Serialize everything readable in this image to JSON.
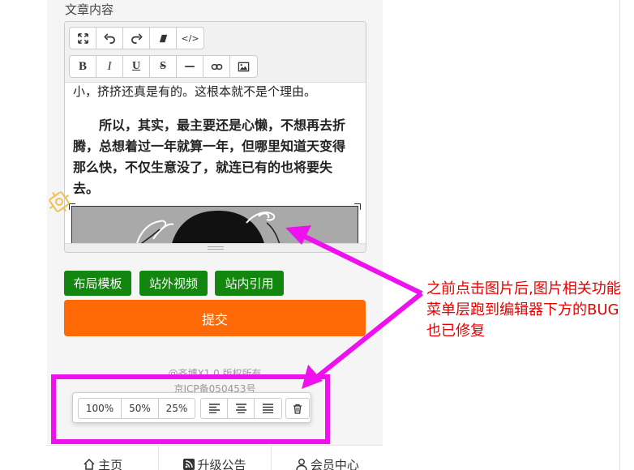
{
  "form": {
    "content_label": "文章内容"
  },
  "editor": {
    "toolbar_row1": [
      {
        "name": "fullscreen-icon"
      },
      {
        "name": "undo-icon"
      },
      {
        "name": "redo-icon"
      },
      {
        "name": "eraser-icon"
      },
      {
        "name": "code-icon",
        "label": "</>"
      }
    ],
    "toolbar_row2": [
      {
        "name": "bold-icon",
        "label": "B"
      },
      {
        "name": "italic-icon",
        "label": "I"
      },
      {
        "name": "underline-icon",
        "label": "U"
      },
      {
        "name": "strikethrough-icon",
        "label": "S"
      },
      {
        "name": "horizontal-rule-icon",
        "label": "—"
      },
      {
        "name": "link-icon"
      },
      {
        "name": "image-icon"
      }
    ],
    "paragraph1": "小，挤挤还真是有的。这根本就不是个理由。",
    "paragraph2": "所以，其实，最主要还是心懒，不想再去折腾，总想着过一年就算一年，但哪里知道天变得那么快，不仅生意没了，就连已有的也将要失去。"
  },
  "buttons": {
    "layout_template": "布局模板",
    "external_video": "站外视频",
    "internal_reference": "站内引用",
    "submit": "提交"
  },
  "footer": {
    "copyright": "@齐博X1.0 版权所有",
    "icp": "京ICP备050453号"
  },
  "image_popup": {
    "sizes": [
      "100%",
      "50%",
      "25%"
    ],
    "align_icons": [
      "align-left-icon",
      "align-center-icon",
      "align-justify-icon"
    ],
    "delete_icon": "trash-icon"
  },
  "tabbar": {
    "home": "主页",
    "upgrade": "升级公告",
    "member": "会员中心"
  },
  "annotation": {
    "text": "之前点击图片后,图片相关功能菜单层跑到编辑器下方的BUG也已修复",
    "color": "#e60000",
    "highlight_color": "#ee11ee"
  }
}
